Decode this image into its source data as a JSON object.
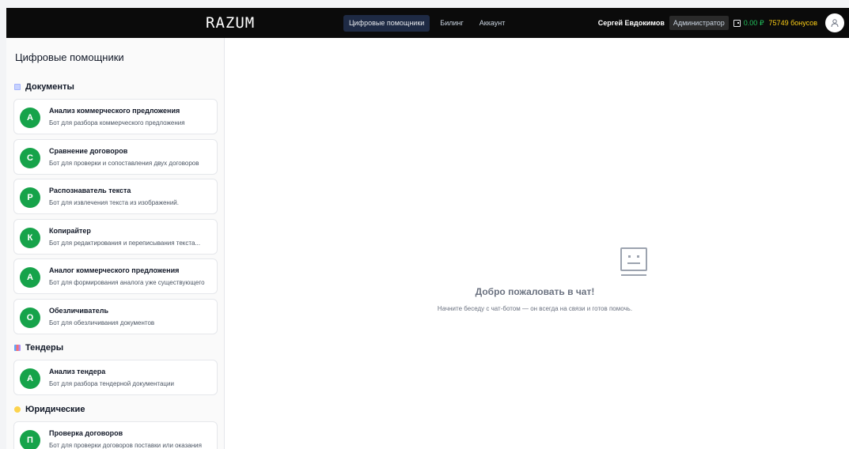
{
  "header": {
    "logo": "RAZUM",
    "nav": [
      {
        "label": "Цифровые помощники",
        "active": true
      },
      {
        "label": "Билинг",
        "active": false
      },
      {
        "label": "Аккаунт",
        "active": false
      }
    ],
    "user_name": "Сергей Евдокимов",
    "role": "Администратор",
    "balance": "0.00 ₽",
    "bonus": "75749 бонусов",
    "colors": {
      "bar": "#0b0b0b",
      "balance": "#22c55e",
      "bonus": "#facc15"
    }
  },
  "sidebar": {
    "title": "Цифровые помощники",
    "sections": [
      {
        "name": "Документы",
        "icon": "document-icon",
        "bots": [
          {
            "letter": "А",
            "title": "Анализ коммерческого предложения",
            "desc": "Бот для разбора коммерческого предложения"
          },
          {
            "letter": "С",
            "title": "Сравнение договоров",
            "desc": "Бот для проверки и сопоставления двух договоров"
          },
          {
            "letter": "Р",
            "title": "Распознаватель текста",
            "desc": "Бот для извлечения текста из изображений."
          },
          {
            "letter": "К",
            "title": "Копирайтер",
            "desc": "Бот для редактирования и переписывания текста..."
          },
          {
            "letter": "А",
            "title": "Аналог коммерческого предложения",
            "desc": "Бот для формирования аналога уже существующего"
          },
          {
            "letter": "О",
            "title": "Обезличиватель",
            "desc": "Бот для обезличивания документов"
          }
        ]
      },
      {
        "name": "Тендеры",
        "icon": "bar-chart-icon",
        "bots": [
          {
            "letter": "А",
            "title": "Анализ тендера",
            "desc": "Бот для разбора тендерной документации"
          }
        ]
      },
      {
        "name": "Юридические",
        "icon": "scales-icon",
        "bots": [
          {
            "letter": "П",
            "title": "Проверка договоров",
            "desc": "Бот для проверки договоров поставки или оказания"
          }
        ]
      }
    ],
    "avatar_color": "#16a34a"
  },
  "main": {
    "welcome_title": "Добро пожаловать в чат!",
    "welcome_subtitle": "Начните беседу с чат-ботом — он всегда на связи и готов помочь."
  }
}
